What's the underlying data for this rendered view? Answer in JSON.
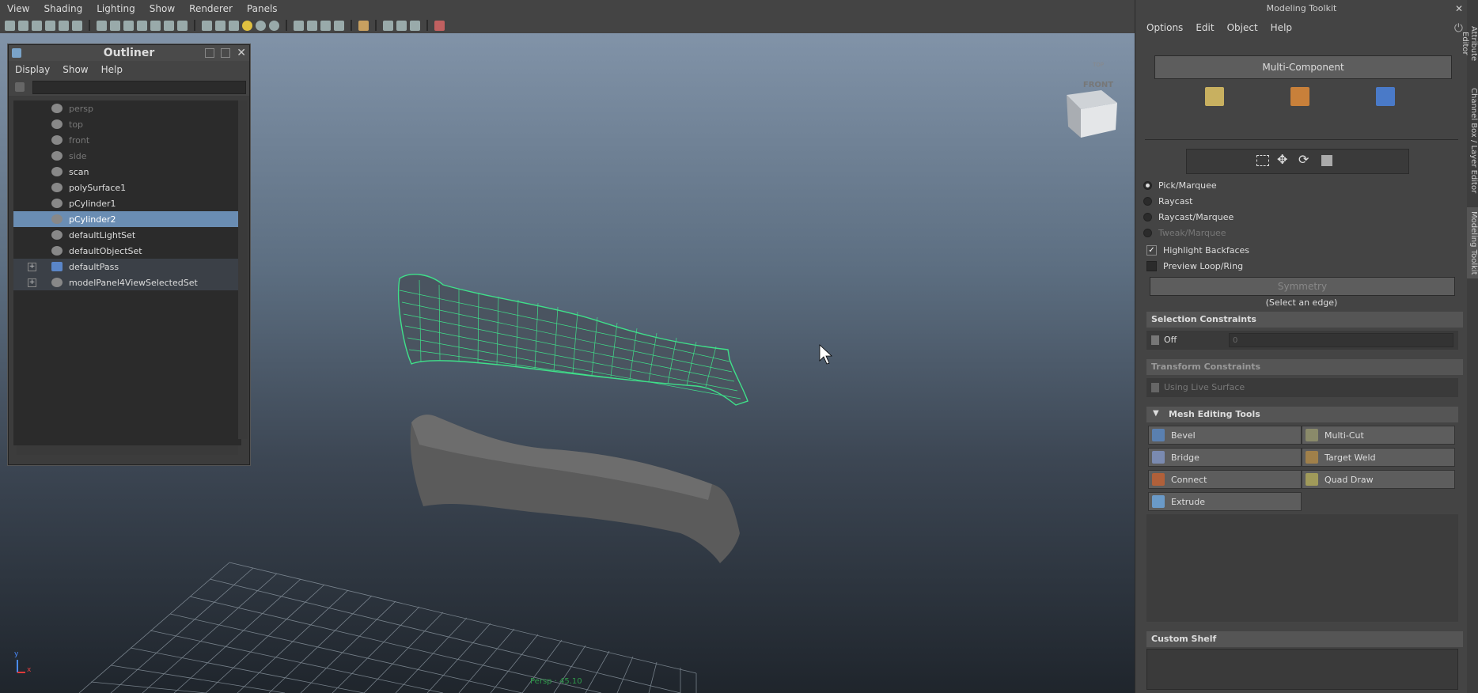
{
  "menubar": {
    "items": [
      "View",
      "Shading",
      "Lighting",
      "Show",
      "Renderer",
      "Panels"
    ]
  },
  "viewport": {
    "viewcube_label": "FRONT",
    "viewcube_top": "TOP",
    "status_text": "Persp · 45.10",
    "axis_x": "x",
    "axis_y": "y"
  },
  "outliner": {
    "title": "Outliner",
    "menu": [
      "Display",
      "Show",
      "Help"
    ],
    "items": [
      {
        "label": "persp",
        "state": "dim"
      },
      {
        "label": "top",
        "state": "dim"
      },
      {
        "label": "front",
        "state": "dim"
      },
      {
        "label": "side",
        "state": "dim"
      },
      {
        "label": "scan",
        "state": "normal"
      },
      {
        "label": "polySurface1",
        "state": "normal"
      },
      {
        "label": "pCylinder1",
        "state": "normal"
      },
      {
        "label": "pCylinder2",
        "state": "selected"
      },
      {
        "label": "defaultLightSet",
        "state": "normal"
      },
      {
        "label": "defaultObjectSet",
        "state": "normal"
      },
      {
        "label": "defaultPass",
        "state": "set"
      },
      {
        "label": "modelPanel4ViewSelectedSet",
        "state": "set"
      }
    ]
  },
  "modeling_toolkit": {
    "title": "Modeling Toolkit",
    "menu": [
      "Options",
      "Edit",
      "Object",
      "Help"
    ],
    "multi_component": "Multi-Component",
    "pick_options": [
      {
        "label": "Pick/Marquee",
        "on": true,
        "dim": false
      },
      {
        "label": "Raycast",
        "on": false,
        "dim": false
      },
      {
        "label": "Raycast/Marquee",
        "on": false,
        "dim": false
      },
      {
        "label": "Tweak/Marquee",
        "on": false,
        "dim": true
      }
    ],
    "highlight_backfaces": "Highlight Backfaces",
    "preview_loop": "Preview Loop/Ring",
    "symmetry": "Symmetry",
    "select_edge": "(Select an edge)",
    "selection_constraints": "Selection Constraints",
    "sel_off": "Off",
    "sel_value": "0",
    "transform_constraints": "Transform Constraints",
    "using_live_surface": "Using Live Surface",
    "mesh_editing_tools": "Mesh Editing Tools",
    "tools": [
      "Bevel",
      "Multi-Cut",
      "Bridge",
      "Target Weld",
      "Connect",
      "Quad Draw",
      "Extrude"
    ],
    "custom_shelf": "Custom Shelf"
  },
  "side_tabs": [
    "Attribute Editor",
    "Channel Box / Layer Editor",
    "Modeling Toolkit"
  ]
}
